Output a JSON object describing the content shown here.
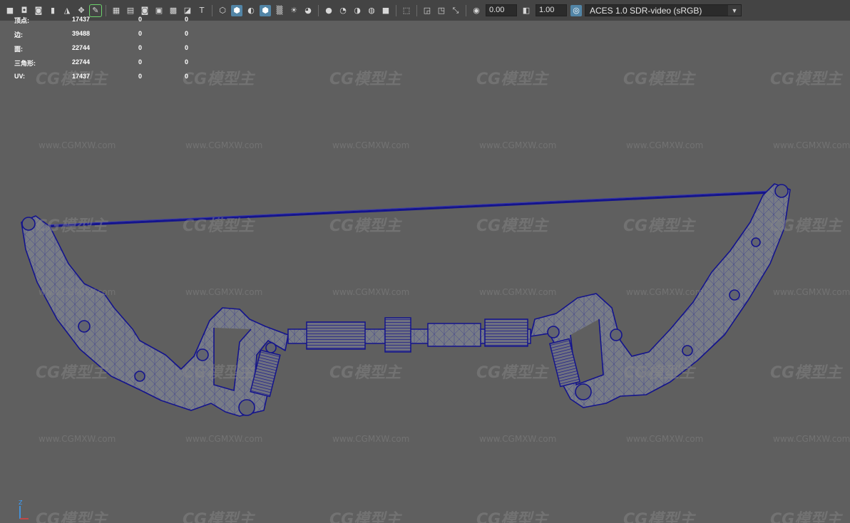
{
  "toolbar": {
    "exposure_value": "0.00",
    "gamma_value": "1.00",
    "color_management": "ACES 1.0 SDR-video (sRGB)",
    "icons": [
      "camera-icon",
      "camera-lock-icon",
      "camera-attributes-icon",
      "bookmark-icon",
      "image-plane-icon",
      "2d-pan-zoom-icon",
      "grease-pencil-icon",
      "grid-icon",
      "film-gate-icon",
      "resolution-gate-icon",
      "gate-mask-icon",
      "field-chart-icon",
      "safe-action-icon",
      "safe-title-icon",
      "wireframe-icon",
      "smooth-shade-icon",
      "default-material-icon",
      "wireframe-on-shaded-icon",
      "xray-icon",
      "use-all-lights-icon",
      "shadows-icon",
      "screen-space-ao-icon",
      "motion-blur-icon",
      "multisample-aa-icon",
      "depth-of-field-icon",
      "isolate-select-icon",
      "xray-joints-icon",
      "xray-active-icon",
      "backface-cull-icon",
      "exposure-icon",
      "gamma-icon",
      "color-management-icon"
    ]
  },
  "hud": {
    "rows": [
      {
        "label": "顶点:",
        "v1": "17437",
        "v2": "0",
        "v3": "0"
      },
      {
        "label": "边:",
        "v1": "39488",
        "v2": "0",
        "v3": "0"
      },
      {
        "label": "面:",
        "v1": "22744",
        "v2": "0",
        "v3": "0"
      },
      {
        "label": "三角形:",
        "v1": "22744",
        "v2": "0",
        "v3": "0"
      },
      {
        "label": "UV:",
        "v1": "17437",
        "v2": "0",
        "v3": "0"
      }
    ]
  },
  "watermark": {
    "logo": "CG模型主",
    "url": "www.CGMXW.com"
  },
  "colors": {
    "background": "#5f5f5f",
    "wire": "#14148c",
    "toolbar": "#444444",
    "highlight": "#5285a6"
  }
}
